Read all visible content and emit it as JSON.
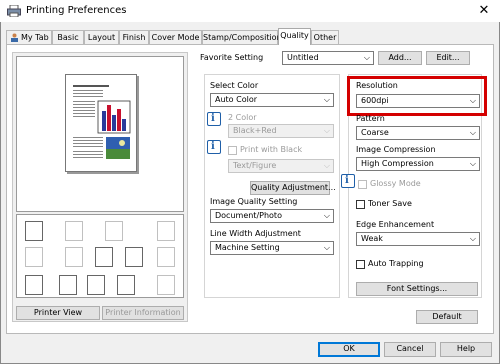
{
  "window": {
    "title": "Printing Preferences",
    "close_glyph": "✕"
  },
  "tabs": [
    {
      "label": "My Tab"
    },
    {
      "label": "Basic"
    },
    {
      "label": "Layout"
    },
    {
      "label": "Finish"
    },
    {
      "label": "Cover Mode"
    },
    {
      "label": "Stamp/Composition"
    },
    {
      "label": "Quality"
    },
    {
      "label": "Other"
    }
  ],
  "active_tab": "Quality",
  "favorite": {
    "label": "Favorite Setting",
    "value": "Untitled",
    "add_label": "Add...",
    "edit_label": "Edit..."
  },
  "quality": {
    "select_color": {
      "label": "Select Color",
      "value": "Auto Color"
    },
    "two_color": {
      "label": "2 Color",
      "value": "Black+Red"
    },
    "print_with_black": {
      "label": "Print with Black",
      "value": "Text/Figure",
      "checked": false
    },
    "quality_adjustment_label": "Quality Adjustment...",
    "image_quality": {
      "label": "Image Quality Setting",
      "value": "Document/Photo"
    },
    "line_width": {
      "label": "Line Width Adjustment",
      "value": "Machine Setting"
    },
    "resolution": {
      "label": "Resolution",
      "value": "600dpi"
    },
    "pattern": {
      "label": "Pattern",
      "value": "Coarse"
    },
    "image_compression": {
      "label": "Image Compression",
      "value": "High Compression"
    },
    "glossy_mode": {
      "label": "Glossy Mode",
      "checked": false
    },
    "toner_save": {
      "label": "Toner Save",
      "checked": false
    },
    "edge_enhancement": {
      "label": "Edge Enhancement",
      "value": "Weak"
    },
    "auto_trapping": {
      "label": "Auto Trapping",
      "checked": false
    },
    "font_settings_label": "Font Settings...",
    "default_label": "Default"
  },
  "preview": {
    "printer_view_label": "Printer View",
    "printer_information_label": "Printer Information"
  },
  "footer": {
    "ok_label": "OK",
    "cancel_label": "Cancel",
    "help_label": "Help"
  },
  "colors": {
    "highlight": "#d40000",
    "accent": "#0078d7",
    "info": "#1f5fa8"
  },
  "info_glyph": "i"
}
